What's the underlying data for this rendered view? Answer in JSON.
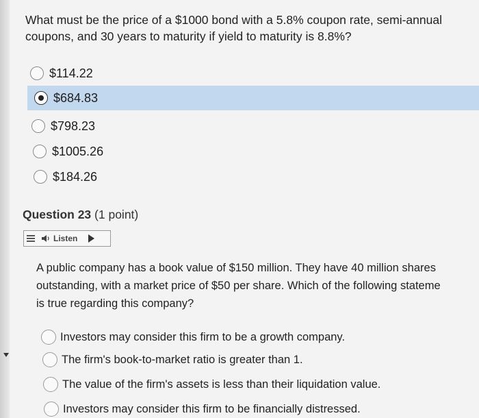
{
  "question22": {
    "text": "What must be the price of a $1000 bond with a 5.8% coupon rate, semi-annual coupons, and 30 years to maturity if yield to maturity is 8.8%?",
    "options": [
      {
        "label": "$114.22",
        "selected": false
      },
      {
        "label": "$684.83",
        "selected": true
      },
      {
        "label": "$798.23",
        "selected": false
      },
      {
        "label": "$1005.26",
        "selected": false
      },
      {
        "label": "$184.26",
        "selected": false
      }
    ]
  },
  "question23": {
    "heading": "Question 23",
    "points": "(1 point)",
    "listen_label": "Listen",
    "text_lines": [
      "A public company has a book value of $150 million. They have 40 million shares",
      "outstanding, with a market price of $50 per share. Which of the following stateme",
      "is true regarding this company?"
    ],
    "options": [
      {
        "label": "Investors may consider this firm to be a growth company.",
        "selected": false
      },
      {
        "label": "The firm's book-to-market ratio is greater than 1.",
        "selected": false
      },
      {
        "label": "The value of the firm's assets is less than their liquidation value.",
        "selected": false
      },
      {
        "label": "Investors may consider this firm to be financially distressed.",
        "selected": false
      }
    ]
  },
  "colors": {
    "selected_highlight": "#c2d8ee",
    "page_background": "#f3f3f3"
  }
}
